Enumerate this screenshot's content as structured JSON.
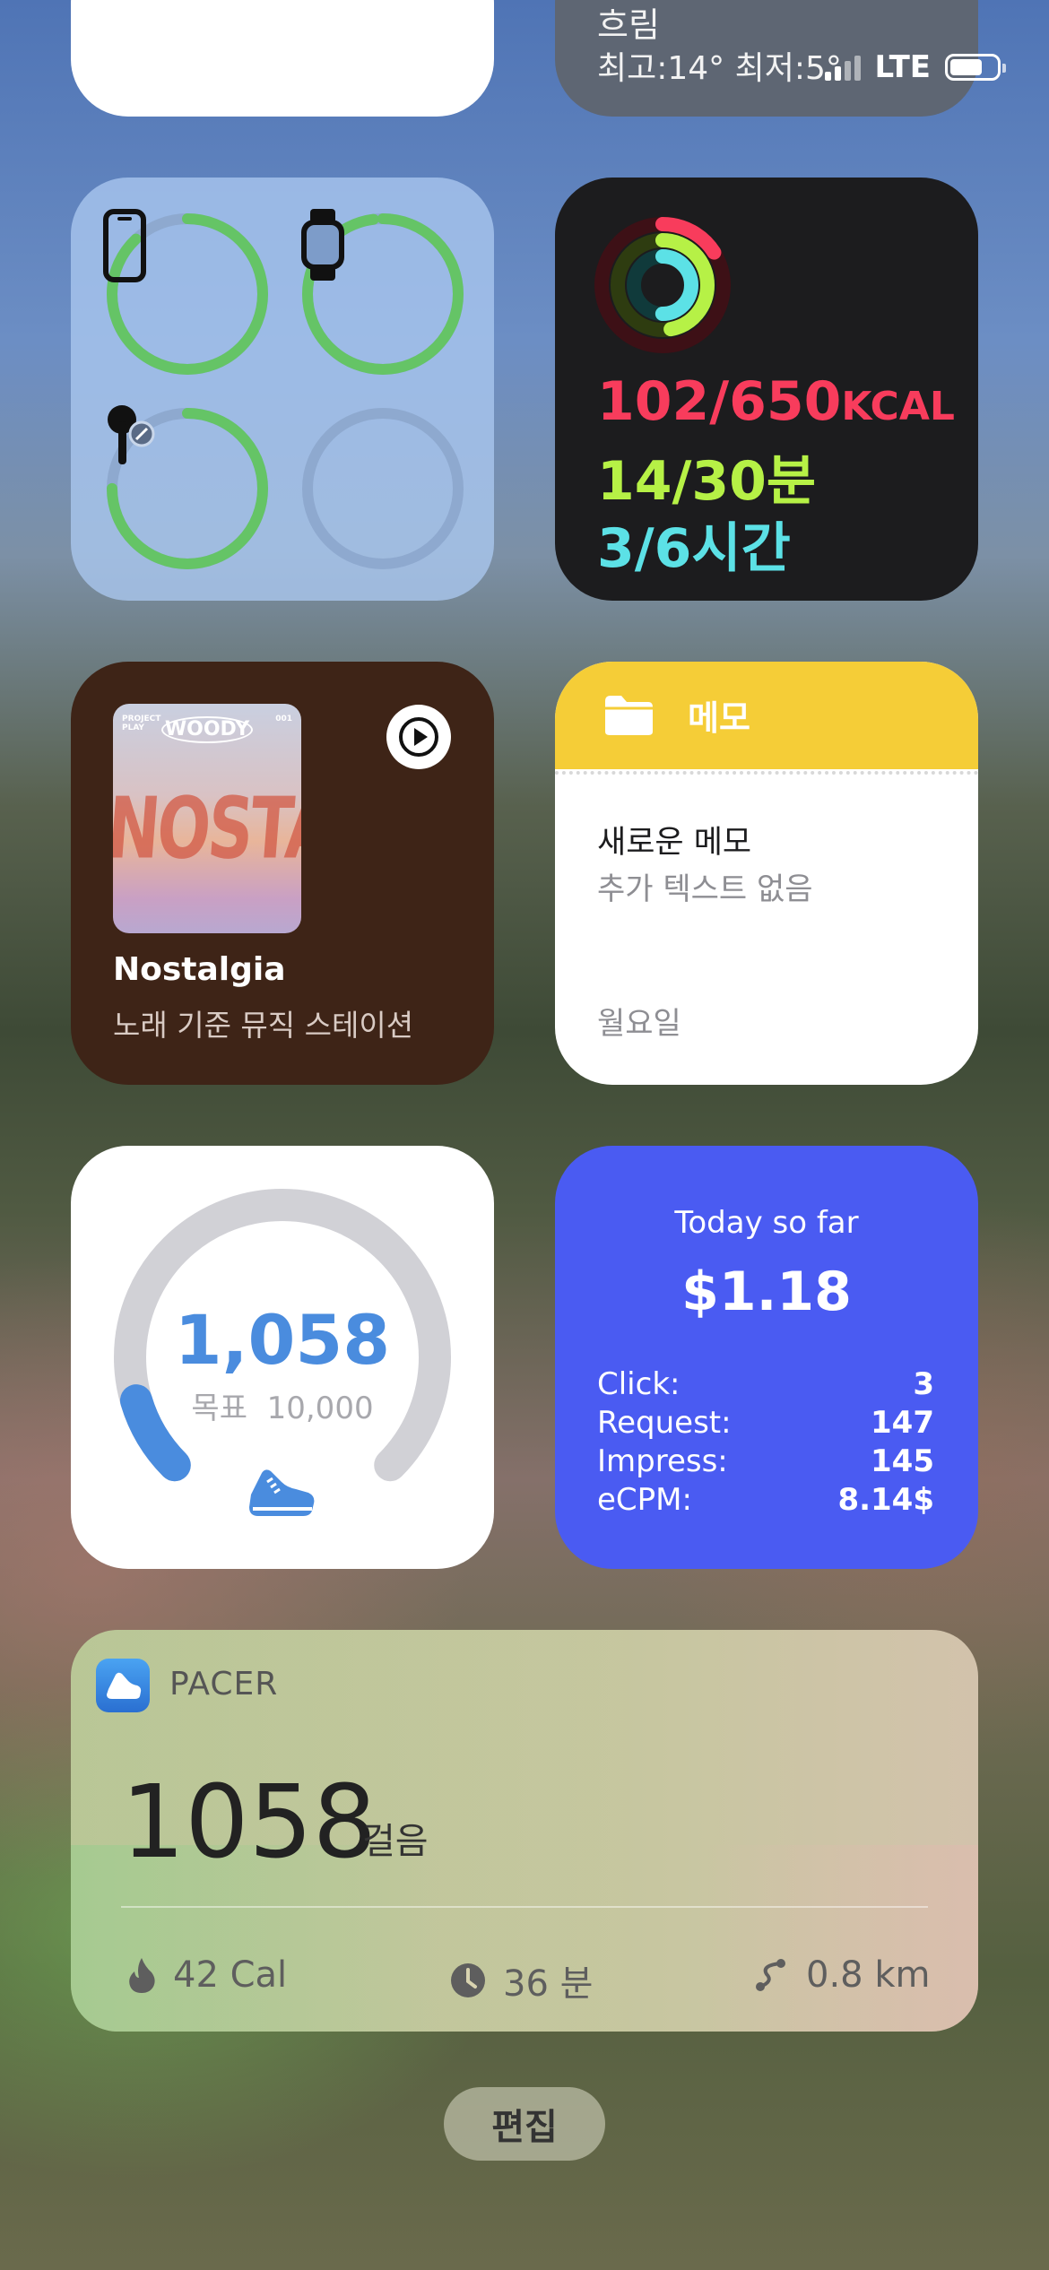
{
  "status_bar": {
    "network": "LTE",
    "battery_level": 0.7
  },
  "weather": {
    "condition": "흐림",
    "hi_lo": "최고:14° 최저:5°"
  },
  "batteries": {
    "devices": [
      {
        "icon": "iphone-icon",
        "level": 0.88
      },
      {
        "icon": "apple-watch-icon",
        "level": 0.98
      },
      {
        "icon": "airpod-icon",
        "level": 0.75
      },
      {
        "icon": "empty-slot",
        "level": 0
      }
    ],
    "colors": {
      "charge": "#65c466",
      "track": "#8ea9cf"
    }
  },
  "activity": {
    "move": "102/650",
    "move_unit": "KCAL",
    "exercise": "14/30분",
    "stand": "3/6시간",
    "rings": [
      {
        "name": "move",
        "progress": 0.16,
        "color": "#f83c5c"
      },
      {
        "name": "exercise",
        "progress": 0.47,
        "color": "#b6f146"
      },
      {
        "name": "stand",
        "progress": 0.5,
        "color": "#5ce1e6"
      }
    ]
  },
  "music": {
    "title": "Nostalgia",
    "subtitle": "노래 기준 뮤직 스테이션",
    "album_label_tl": "PROJECT\nPLAY",
    "album_label_tr": "001",
    "album_brand": "WOODY",
    "album_art_text": "NOSTALGIA"
  },
  "notes": {
    "app_name": "메모",
    "note_title": "새로운 메모",
    "note_body": "추가 텍스트 없음",
    "note_date": "월요일"
  },
  "steps_ring": {
    "steps": "1,058",
    "goal_label": "목표",
    "goal": "10,000",
    "progress": 0.1058,
    "colors": {
      "accent": "#4a8cde",
      "track": "#d1d1d6"
    }
  },
  "earnings": {
    "header": "Today so far",
    "amount": "$1.18",
    "rows": [
      {
        "label": "Click:",
        "value": "3"
      },
      {
        "label": "Request:",
        "value": "147"
      },
      {
        "label": "Impress:",
        "value": "145"
      },
      {
        "label": "eCPM:",
        "value": "8.14$"
      }
    ]
  },
  "pacer": {
    "app_name": "PACER",
    "steps": "1058",
    "steps_unit": "걸음",
    "stats": [
      {
        "icon": "flame-icon",
        "value": "42 Cal"
      },
      {
        "icon": "clock-icon",
        "value": "36 분"
      },
      {
        "icon": "route-icon",
        "value": "0.8 km"
      }
    ]
  },
  "edit_button": "편집"
}
